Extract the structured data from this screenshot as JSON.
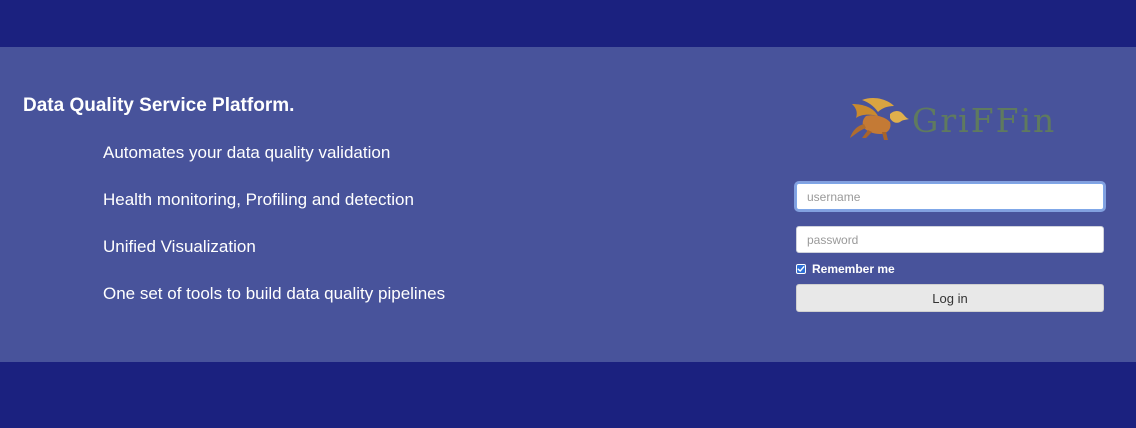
{
  "intro": {
    "headline": "Data Quality Service Platform.",
    "features": [
      "Automates your data quality validation",
      "Health monitoring, Profiling and detection",
      "Unified Visualization",
      "One set of tools to build data quality pipelines"
    ]
  },
  "logo": {
    "text": "GriFFin",
    "icon": "griffin-icon"
  },
  "login": {
    "username_value": "",
    "username_placeholder": "username",
    "password_value": "",
    "password_placeholder": "password",
    "remember_label": "Remember me",
    "remember_checked": true,
    "submit_label": "Log in"
  },
  "colors": {
    "page_background": "#1b217f",
    "band_background": "#48539b",
    "checkbox_accent": "#2c6fd6"
  }
}
